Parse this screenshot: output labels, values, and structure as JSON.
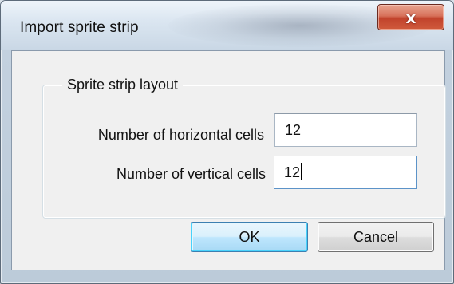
{
  "window": {
    "title": "Import sprite strip",
    "close_glyph": "x"
  },
  "group": {
    "legend": "Sprite strip layout"
  },
  "fields": {
    "horizontal_label": "Number of horizontal cells",
    "horizontal_value": "12",
    "vertical_label": "Number of vertical cells",
    "vertical_value": "12"
  },
  "buttons": {
    "ok_label": "OK",
    "cancel_label": "Cancel"
  },
  "icons": {
    "close": "close-icon"
  },
  "colors": {
    "close_button": "#c1432c",
    "default_button_border": "#3c7fb1",
    "focus_border": "#5c93c8"
  }
}
